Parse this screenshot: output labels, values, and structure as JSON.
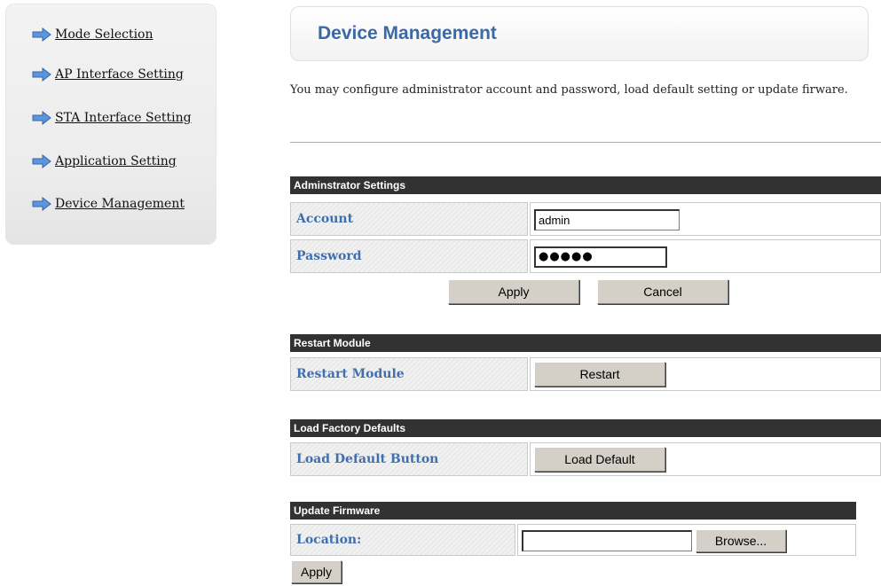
{
  "sidebar": {
    "items": [
      {
        "label": "Mode Selection"
      },
      {
        "label": "AP Interface Setting"
      },
      {
        "label": "STA Interface Setting"
      },
      {
        "label": "Application Setting"
      },
      {
        "label": "Device Management"
      }
    ]
  },
  "header": {
    "title": "Device Management",
    "description": "You may configure administrator account and password, load default setting or update firware."
  },
  "admin": {
    "section_title": "Adminstrator Settings",
    "account_label": "Account",
    "account_value": "admin",
    "password_label": "Password",
    "password_mask": "●●●●●",
    "apply_label": "Apply",
    "cancel_label": "Cancel"
  },
  "restart": {
    "section_title": "Restart Module",
    "row_label": "Restart Module",
    "button_label": "Restart"
  },
  "factory": {
    "section_title": "Load Factory Defaults",
    "row_label": "Load Default Button",
    "button_label": "Load Default"
  },
  "firmware": {
    "section_title": "Update Firmware",
    "location_label": "Location:",
    "location_value": "",
    "browse_label": "Browse...",
    "apply_label": "Apply"
  },
  "colors": {
    "accent": "#3a69a8",
    "section_bar": "#323232",
    "arrow": "#4a86d4"
  },
  "icons": {
    "nav_arrow": "arrow-right-icon"
  }
}
